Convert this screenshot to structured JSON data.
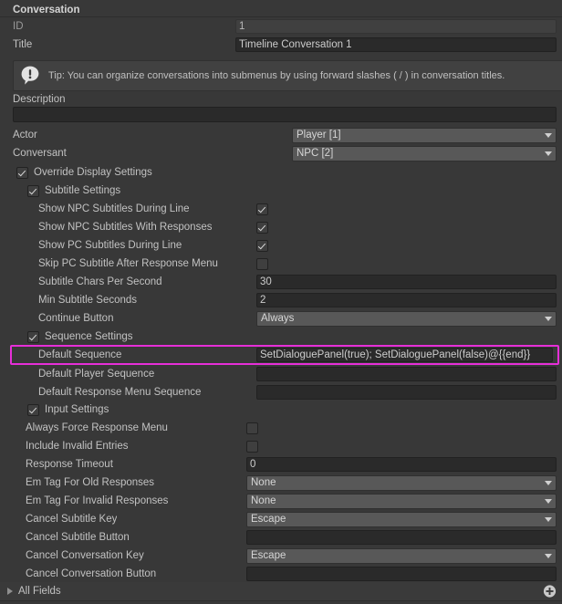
{
  "section": {
    "title": "Conversation"
  },
  "fields": {
    "id": {
      "label": "ID",
      "value": "1"
    },
    "title": {
      "label": "Title",
      "value": "Timeline Conversation 1"
    },
    "description": {
      "label": "Description",
      "value": ""
    },
    "actor": {
      "label": "Actor",
      "value": "Player [1]"
    },
    "conversant": {
      "label": "Conversant",
      "value": "NPC [2]"
    }
  },
  "tip": {
    "icon": "info-exclamation-icon",
    "text": "Tip: You can organize conversations into submenus by using forward slashes ( / ) in conversation titles."
  },
  "override_display_settings": {
    "label": "Override Display Settings",
    "checked": true
  },
  "subtitle_settings": {
    "label": "Subtitle Settings",
    "checked": true,
    "rows": [
      {
        "label": "Show NPC Subtitles During Line",
        "type": "checkbox",
        "checked": true
      },
      {
        "label": "Show NPC Subtitles With Responses",
        "type": "checkbox",
        "checked": true
      },
      {
        "label": "Show PC Subtitles During Line",
        "type": "checkbox",
        "checked": true
      },
      {
        "label": "Skip PC Subtitle After Response Menu",
        "type": "checkbox",
        "checked": false
      },
      {
        "label": "Subtitle Chars Per Second",
        "type": "text",
        "value": "30"
      },
      {
        "label": "Min Subtitle Seconds",
        "type": "text",
        "value": "2"
      },
      {
        "label": "Continue Button",
        "type": "dropdown",
        "value": "Always"
      }
    ]
  },
  "sequence_settings": {
    "label": "Sequence Settings",
    "checked": true,
    "rows": [
      {
        "label": "Default Sequence",
        "type": "text",
        "value": "SetDialoguePanel(true); SetDialoguePanel(false)@{{end}}",
        "highlighted": true
      },
      {
        "label": "Default Player Sequence",
        "type": "text",
        "value": ""
      },
      {
        "label": "Default Response Menu Sequence",
        "type": "text",
        "value": ""
      }
    ]
  },
  "input_settings": {
    "label": "Input Settings",
    "checked": true,
    "rows": [
      {
        "label": "Always Force Response Menu",
        "type": "checkbox",
        "checked": false
      },
      {
        "label": "Include Invalid Entries",
        "type": "checkbox",
        "checked": false
      },
      {
        "label": "Response Timeout",
        "type": "text",
        "value": "0"
      },
      {
        "label": "Em Tag For Old Responses",
        "type": "dropdown",
        "value": "None"
      },
      {
        "label": "Em Tag For Invalid Responses",
        "type": "dropdown",
        "value": "None"
      },
      {
        "label": "Cancel Subtitle Key",
        "type": "dropdown",
        "value": "Escape"
      },
      {
        "label": "Cancel Subtitle Button",
        "type": "text",
        "value": ""
      },
      {
        "label": "Cancel Conversation Key",
        "type": "dropdown",
        "value": "Escape"
      },
      {
        "label": "Cancel Conversation Button",
        "type": "text",
        "value": ""
      }
    ]
  },
  "all_fields": {
    "label": "All Fields",
    "expanded": false,
    "add_icon": "plus-circle-icon"
  },
  "colors": {
    "background": "#383838",
    "field_bg": "#2a2a2a",
    "dropdown_bg": "#585858",
    "highlight": "#e62fd8",
    "text": "#c2c2c2"
  }
}
